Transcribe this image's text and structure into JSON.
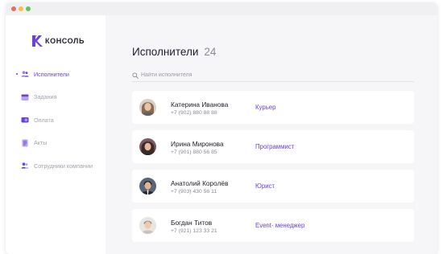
{
  "window": {
    "controls": [
      "close",
      "minimize",
      "maximize"
    ]
  },
  "brand": {
    "name": "КОНСОЛЬ",
    "logo_icon": "konsol-logo-icon",
    "color": "#6b41d6"
  },
  "sidebar": {
    "items": [
      {
        "label": "Исполнители",
        "icon": "users-icon",
        "active": true
      },
      {
        "label": "Задания",
        "icon": "tasks-icon",
        "active": false
      },
      {
        "label": "Оплата",
        "icon": "payment-icon",
        "active": false
      },
      {
        "label": "Акты",
        "icon": "document-icon",
        "active": false
      },
      {
        "label": "Сотрудники компании",
        "icon": "staff-icon",
        "active": false
      }
    ]
  },
  "main": {
    "title": "Исполнители",
    "count": "24",
    "search": {
      "placeholder": "Найти исполнителя",
      "value": ""
    },
    "performers": [
      {
        "name": "Катерина Иванова",
        "phone": "+7 (902) 880 88 88",
        "role": "Курьер"
      },
      {
        "name": "Ирина Миронова",
        "phone": "+7 (901) 880 56 85",
        "role": "Программист"
      },
      {
        "name": "Анатолий Королёв",
        "phone": "+7 (903) 430 56 11",
        "role": "Юрист"
      },
      {
        "name": "Богдан Титов",
        "phone": "+7 (921) 123 33 21",
        "role": "Event- менеджер"
      }
    ]
  },
  "colors": {
    "accent": "#6b41d6",
    "accent_light": "#9c7ef0",
    "text": "#1d1d2b",
    "muted": "#8a8a95",
    "background": "#f6f6f8"
  }
}
